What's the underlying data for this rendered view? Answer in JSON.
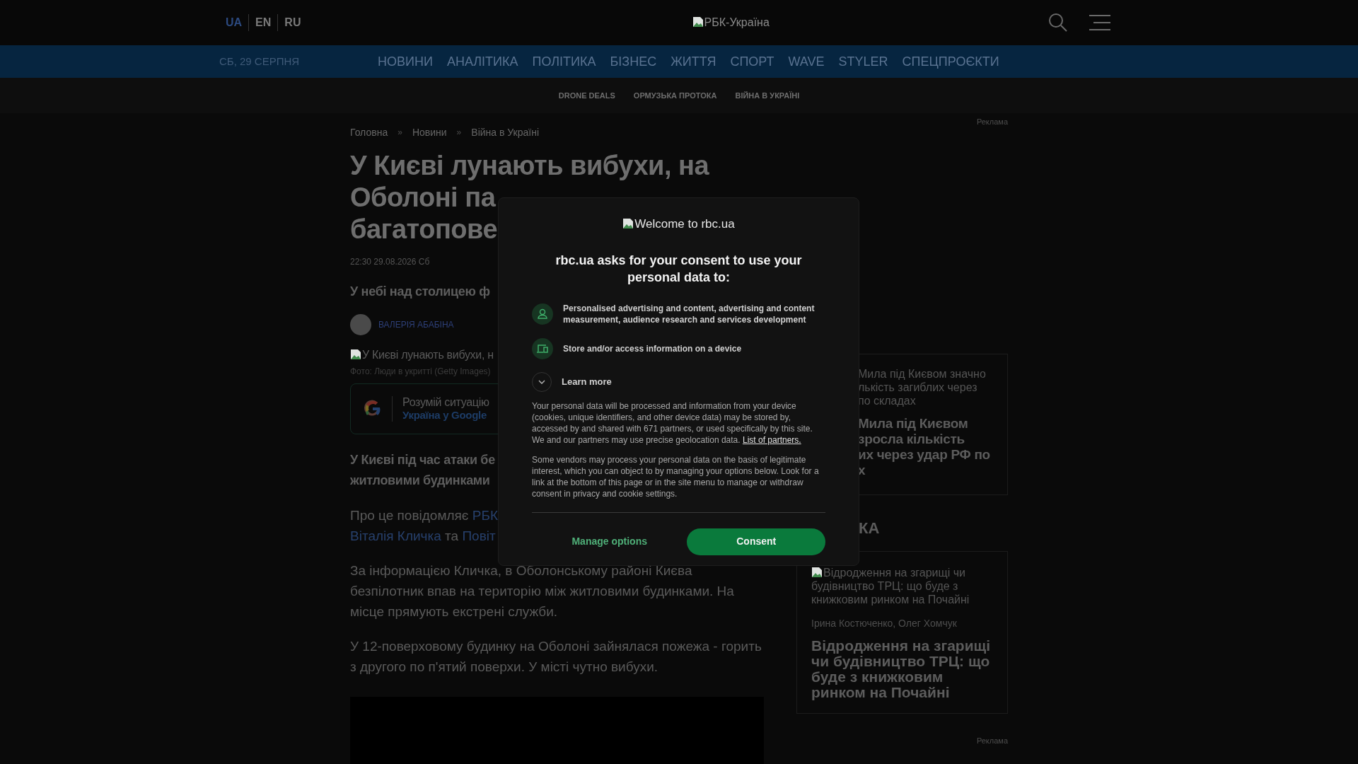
{
  "header": {
    "languages": [
      {
        "label": "UA",
        "selected": true
      },
      {
        "label": "EN",
        "selected": false
      },
      {
        "label": "RU",
        "selected": false
      }
    ],
    "logo_alt": "РБК-Україна"
  },
  "nav": {
    "date": "СБ, 29 СЕРПНЯ",
    "items": [
      "НОВИНИ",
      "АНАЛІТИКА",
      "ПОЛІТИКА",
      "БІЗНЕС",
      "ЖИТТЯ",
      "СПОРТ",
      "WAVE",
      "STYLER",
      "СПЕЦПРОЄКТИ"
    ]
  },
  "subnav": [
    "DRONE DEALS",
    "ОРМУЗЬКА ПРОТОКА",
    "ВІЙНА В УКРАЇНІ"
  ],
  "ad_top": "Реклама",
  "breadcrumb": [
    {
      "kind": "link",
      "text": "Головна"
    },
    {
      "kind": "separator",
      "text": "»"
    },
    {
      "kind": "link",
      "text": "Новини"
    },
    {
      "kind": "separator",
      "text": "»"
    },
    {
      "kind": "link",
      "text": "Війна в Україні"
    }
  ],
  "article": {
    "title_lines": [
      "У Києві лунають вибухи, на",
      "Оболоні па",
      "багатопове"
    ],
    "date": "22:30 29.08.2026 Сб",
    "lead": "У небі над столицею ф",
    "author": "ВАЛЕРІЯ АБАБІНА",
    "image_alt": "У Києві лунають вибухи, н",
    "caption": "Фото: Люди в укритті (Getty Images)",
    "google": {
      "text": "Розумій ситуацію",
      "link": "Україна у Google"
    },
    "paragraphs": [
      {
        "kind": "bold",
        "lines": [
          [
            {
              "kind": "text",
              "text": "У Києві під час атаки бе"
            }
          ],
          [
            {
              "kind": "text",
              "text": "житловими будинками"
            }
          ]
        ]
      },
      {
        "kind": "normal",
        "lines": [
          [
            {
              "kind": "text",
              "text": "Про це повідомляє "
            },
            {
              "kind": "link",
              "text": "РБК"
            }
          ],
          [
            {
              "kind": "link",
              "text": "Віталія Кличка"
            },
            {
              "kind": "text",
              "text": " та "
            },
            {
              "kind": "link",
              "text": "Повіт"
            }
          ]
        ]
      },
      {
        "kind": "normal",
        "lines": [
          [
            {
              "kind": "text",
              "text": "За інформацією Кличка, в Оболонському районі Києва безпілотник впав на територію між житловими будинками. На місце прямують екстрені служби."
            }
          ]
        ]
      },
      {
        "kind": "normal",
        "lines": [
          [
            {
              "kind": "text",
              "text": "У 12-поверховому будинку на Оболоні зайнялася пожежа - горить з другого по п'ятий поверхи. У місті чутно вибухи."
            }
          ]
        ]
      }
    ]
  },
  "sidebar": {
    "card_1": {
      "alt_lines": [
        "Мила під Києвом значно",
        "лькість загиблих через",
        "по складах"
      ],
      "title_lines": [
        "Мила під Києвом",
        "зросла кількість",
        "их через удар РФ по",
        "х"
      ]
    },
    "section_title": "КА",
    "card_2": {
      "alt": "Відродження на згарищі чи будівництво ТРЦ: що буде з книжковим ринком на Почайні",
      "authors": "Ірина Костюченко, Олег Хомчук",
      "title": "Відродження на згарищі чи будівництво ТРЦ: що буде з книжковим ринком на Почайні"
    },
    "ad_bottom": "Реклама"
  },
  "consent": {
    "logo_alt": "Welcome to rbc.ua",
    "heading": "rbc.ua asks for your consent to use your personal data to:",
    "purposes": [
      {
        "kind": "person",
        "text": "Personalised advertising and content, advertising and content measurement, audience research and services development"
      },
      {
        "kind": "device",
        "text": "Store and/or access information on a device"
      }
    ],
    "learn_more": {
      "label": "Learn more",
      "expanded": false
    },
    "notice": {
      "text": "Your personal data will be processed and information from your device (cookies, unique identifiers, and other device data) may be stored by, accessed by and shared with 671 partners, or used specifically by this site. We and our partners may use precise geolocation data. ",
      "link": "List of partners."
    },
    "vendors": "Some vendors may process your personal data on the basis of legitimate interest, which you can object to by managing your options below. Look for a link at the bottom of this page or in the site menu to manage or withdraw consent in privacy and cookie settings.",
    "buttons": {
      "manage": "Manage options",
      "consent": "Consent"
    }
  }
}
